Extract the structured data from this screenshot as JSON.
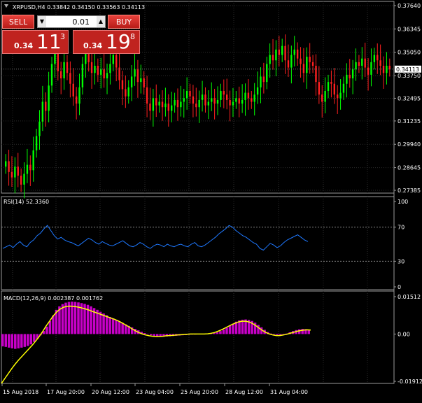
{
  "window": {
    "header": "XRPUSD,H4  0.33842 0.34150 0.33563 0.34113",
    "rsi_header": "RSI(14) 52.3360",
    "macd_header": "MACD(12,26,9) 0.002387 0.001762"
  },
  "trade": {
    "sell_label": "SELL",
    "buy_label": "BUY",
    "lot_value": "0.01",
    "sell_price_small": "0.34",
    "sell_price_big": "11",
    "sell_price_sup": "3",
    "buy_price_small": "0.34",
    "buy_price_big": "19",
    "buy_price_sup": "8",
    "down_arrow": "▼",
    "up_arrow": "▲"
  },
  "colors": {
    "bull": "#00ff00",
    "bear": "#ff2020",
    "rsi": "#1e78ff",
    "macd_hist": "#c800c8",
    "signal": "#ffff00",
    "grid": "#2b2b2b",
    "frame": "#9a9a9a"
  },
  "chart_data": [
    {
      "type": "candlestick",
      "title": "XRPUSD,H4",
      "ylim": [
        0.27385,
        0.3764
      ],
      "y_ticks": [
        "0.37640",
        "0.36345",
        "0.35050",
        "0.33750",
        "0.32495",
        "0.31235",
        "0.29940",
        "0.28645",
        "0.27385"
      ],
      "current_price": "0.34113",
      "closes": [
        0.29,
        0.284,
        0.281,
        0.287,
        0.282,
        0.277,
        0.283,
        0.288,
        0.285,
        0.296,
        0.304,
        0.312,
        0.323,
        0.318,
        0.332,
        0.344,
        0.351,
        0.34,
        0.336,
        0.345,
        0.339,
        0.333,
        0.326,
        0.322,
        0.331,
        0.344,
        0.351,
        0.345,
        0.339,
        0.343,
        0.338,
        0.341,
        0.336,
        0.339,
        0.344,
        0.349,
        0.342,
        0.335,
        0.33,
        0.326,
        0.331,
        0.337,
        0.341,
        0.334,
        0.336,
        0.331,
        0.322,
        0.318,
        0.325,
        0.321,
        0.323,
        0.32,
        0.322,
        0.318,
        0.321,
        0.324,
        0.32,
        0.323,
        0.325,
        0.329,
        0.326,
        0.322,
        0.32,
        0.324,
        0.327,
        0.321,
        0.323,
        0.325,
        0.322,
        0.324,
        0.329,
        0.327,
        0.324,
        0.321,
        0.323,
        0.325,
        0.322,
        0.324,
        0.328,
        0.325,
        0.323,
        0.327,
        0.331,
        0.337,
        0.334,
        0.344,
        0.349,
        0.346,
        0.352,
        0.349,
        0.354,
        0.346,
        0.342,
        0.349,
        0.352,
        0.347,
        0.344,
        0.339,
        0.348,
        0.345,
        0.343,
        0.334,
        0.327,
        0.323,
        0.329,
        0.334,
        0.333,
        0.327,
        0.325,
        0.328,
        0.333,
        0.338,
        0.336,
        0.341,
        0.345,
        0.343,
        0.347,
        0.342,
        0.338,
        0.345,
        0.349,
        0.346,
        0.343,
        0.339,
        0.343,
        0.341
      ]
    },
    {
      "type": "line",
      "title": "RSI(14)",
      "ylim": [
        0,
        100
      ],
      "y_ticks": [
        "100",
        "70",
        "30",
        "0"
      ],
      "levels": [
        70,
        30
      ],
      "values": [
        45,
        47,
        49,
        46,
        50,
        53,
        49,
        47,
        52,
        55,
        60,
        63,
        68,
        72,
        66,
        60,
        56,
        58,
        55,
        53,
        52,
        50,
        48,
        51,
        54,
        57,
        55,
        52,
        50,
        53,
        51,
        49,
        48,
        50,
        52,
        54,
        51,
        48,
        47,
        49,
        52,
        50,
        47,
        45,
        48,
        50,
        49,
        47,
        50,
        48,
        47,
        49,
        50,
        48,
        47,
        50,
        52,
        48,
        47,
        49,
        52,
        55,
        58,
        62,
        65,
        68,
        72,
        70,
        66,
        63,
        60,
        58,
        55,
        52,
        50,
        45,
        43,
        47,
        51,
        49,
        46,
        48,
        52,
        55,
        57,
        59,
        61,
        58,
        55,
        53
      ]
    },
    {
      "type": "bar+line",
      "title": "MACD(12,26,9)",
      "ylim": [
        -0.01912,
        0.01512
      ],
      "y_ticks": [
        "0.01512",
        "0.00",
        "-0.01912"
      ],
      "histogram": [
        -0.005,
        -0.0052,
        -0.0055,
        -0.0058,
        -0.006,
        -0.0058,
        -0.0055,
        -0.0052,
        -0.0048,
        -0.0042,
        -0.0032,
        -0.002,
        -0.0005,
        0.0012,
        0.003,
        0.0052,
        0.0075,
        0.0098,
        0.0112,
        0.0121,
        0.0127,
        0.013,
        0.0131,
        0.013,
        0.0128,
        0.0125,
        0.0122,
        0.0118,
        0.0112,
        0.0105,
        0.0098,
        0.009,
        0.0083,
        0.0076,
        0.0069,
        0.0063,
        0.0057,
        0.0051,
        0.0045,
        0.0039,
        0.0033,
        0.0027,
        0.0021,
        0.0015,
        0.0009,
        0.0004,
        -0.0001,
        -0.0005,
        -0.0008,
        -0.001,
        -0.0011,
        -0.0011,
        -0.001,
        -0.0009,
        -0.0008,
        -0.0007,
        -0.0006,
        -0.0005,
        -0.0004,
        -0.0003,
        -0.0002,
        -0.0002,
        -0.0001,
        -0.0001,
        0.0,
        0.0001,
        0.0002,
        0.0004,
        0.0007,
        0.0012,
        0.0018,
        0.0026,
        0.0034,
        0.0042,
        0.005,
        0.0055,
        0.0058,
        0.0059,
        0.0057,
        0.0053,
        0.0046,
        0.0037,
        0.0027,
        0.0017,
        0.0008,
        0.0002,
        -0.0002,
        -0.0004,
        -0.0004,
        -0.0002,
        0.0002,
        0.0007,
        0.0012,
        0.0016,
        0.0019,
        0.0021,
        0.002,
        0.0017
      ],
      "signal": [
        -0.02,
        -0.018,
        -0.016,
        -0.014,
        -0.0122,
        -0.0105,
        -0.009,
        -0.0075,
        -0.006,
        -0.0045,
        -0.0028,
        -0.001,
        0.001,
        0.0032,
        0.0052,
        0.0072,
        0.0088,
        0.01,
        0.0108,
        0.0112,
        0.0113,
        0.0112,
        0.011,
        0.0107,
        0.0103,
        0.0099,
        0.0094,
        0.0089,
        0.0084,
        0.0079,
        0.0074,
        0.0069,
        0.0064,
        0.0059,
        0.0053,
        0.0046,
        0.0038,
        0.003,
        0.0021,
        0.0013,
        0.0006,
        0.0,
        -0.0004,
        -0.0007,
        -0.0009,
        -0.001,
        -0.001,
        -0.0009,
        -0.0007,
        -0.0006,
        -0.0005,
        -0.0004,
        -0.0003,
        -0.0002,
        -0.0001,
        0.0,
        0.0,
        0.0,
        0.0,
        0.0,
        0.0001,
        0.0003,
        0.0006,
        0.0011,
        0.0017,
        0.0024,
        0.0031,
        0.0038,
        0.0044,
        0.0049,
        0.0052,
        0.0052,
        0.0049,
        0.0043,
        0.0034,
        0.0024,
        0.0014,
        0.0006,
        0.0,
        -0.0004,
        -0.0006,
        -0.0006,
        -0.0004,
        -0.0001,
        0.0003,
        0.0007,
        0.0011,
        0.0014,
        0.0016,
        0.0017,
        0.0016
      ]
    }
  ],
  "x_axis": {
    "labels": [
      "15 Aug 2018",
      "17 Aug 20:00",
      "20 Aug 12:00",
      "23 Aug 04:00",
      "25 Aug 20:00",
      "28 Aug 12:00",
      "31 Aug 04:00"
    ]
  }
}
